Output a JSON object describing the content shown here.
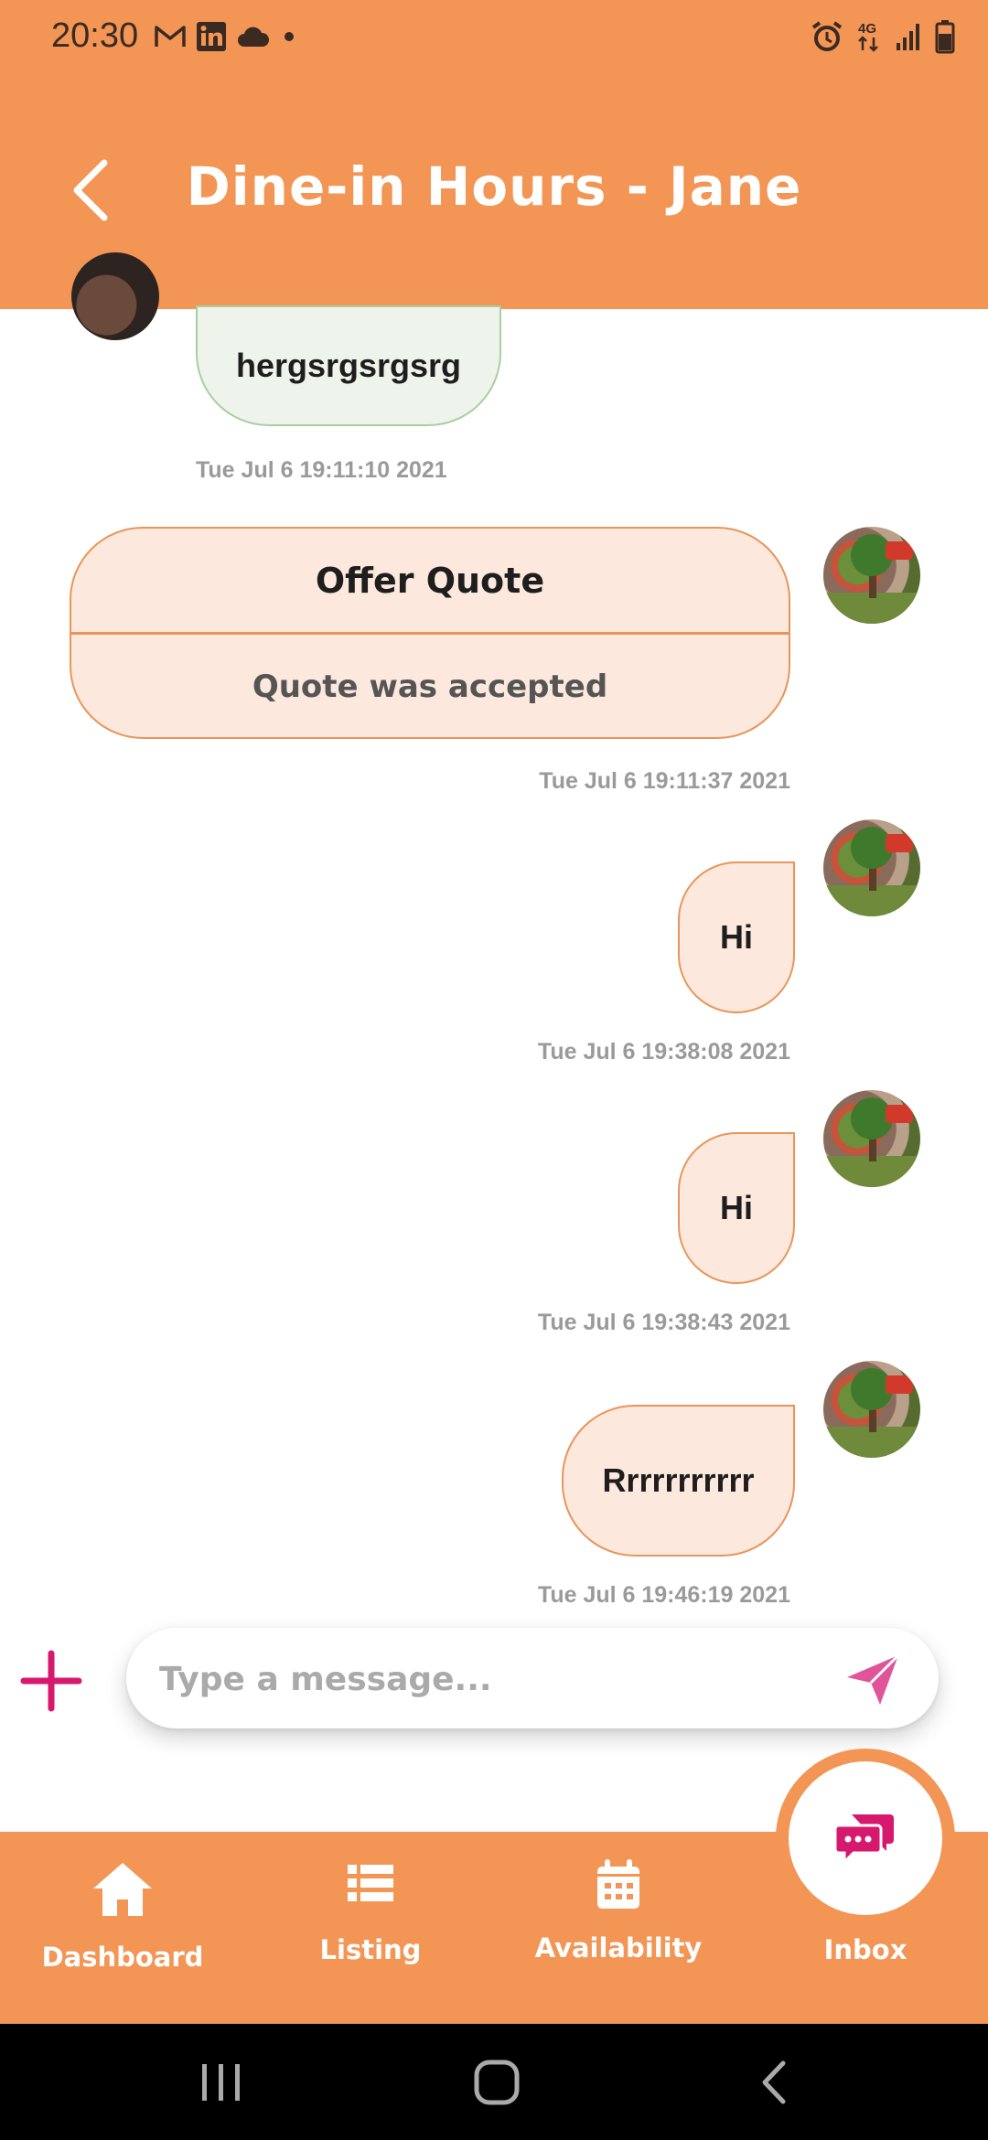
{
  "status_bar": {
    "time": "20:30",
    "left_icons": [
      "gmail-icon",
      "linkedin-icon",
      "cloud-icon",
      "dot-icon"
    ],
    "right_icons": [
      "alarm-icon",
      "network-4g-icon",
      "signal-icon",
      "battery-icon"
    ],
    "network_label": "4G"
  },
  "header": {
    "title": "Dine-in Hours - Jane",
    "background_color": "#F29555"
  },
  "messages": [
    {
      "sender": "other",
      "type": "text",
      "text": "hergsrgsrgsrg",
      "timestamp": "Tue Jul  6 19:11:10 2021"
    },
    {
      "sender": "me",
      "type": "offer",
      "title": "Offer Quote",
      "status": "Quote was accepted",
      "timestamp": "Tue Jul  6 19:11:37 2021"
    },
    {
      "sender": "me",
      "type": "text",
      "text": "Hi",
      "timestamp": "Tue Jul  6 19:38:08 2021"
    },
    {
      "sender": "me",
      "type": "text",
      "text": "Hi",
      "timestamp": "Tue Jul  6 19:38:43 2021"
    },
    {
      "sender": "me",
      "type": "text",
      "text": "Rrrrrrrrrrr",
      "timestamp": "Tue Jul  6 19:46:19 2021"
    }
  ],
  "composer": {
    "placeholder": "Type a message...",
    "value": "",
    "accent_color": "#D6196E"
  },
  "bottom_nav": {
    "items": [
      {
        "label": "Dashboard",
        "icon": "home-icon",
        "active": false
      },
      {
        "label": "Listing",
        "icon": "list-icon",
        "active": false
      },
      {
        "label": "Availability",
        "icon": "calendar-icon",
        "active": false
      },
      {
        "label": "Inbox",
        "icon": "chat-bubbles-icon",
        "active": true
      }
    ]
  },
  "system_nav": [
    "recent-apps-icon",
    "home-circle-icon",
    "back-chevron-icon"
  ]
}
